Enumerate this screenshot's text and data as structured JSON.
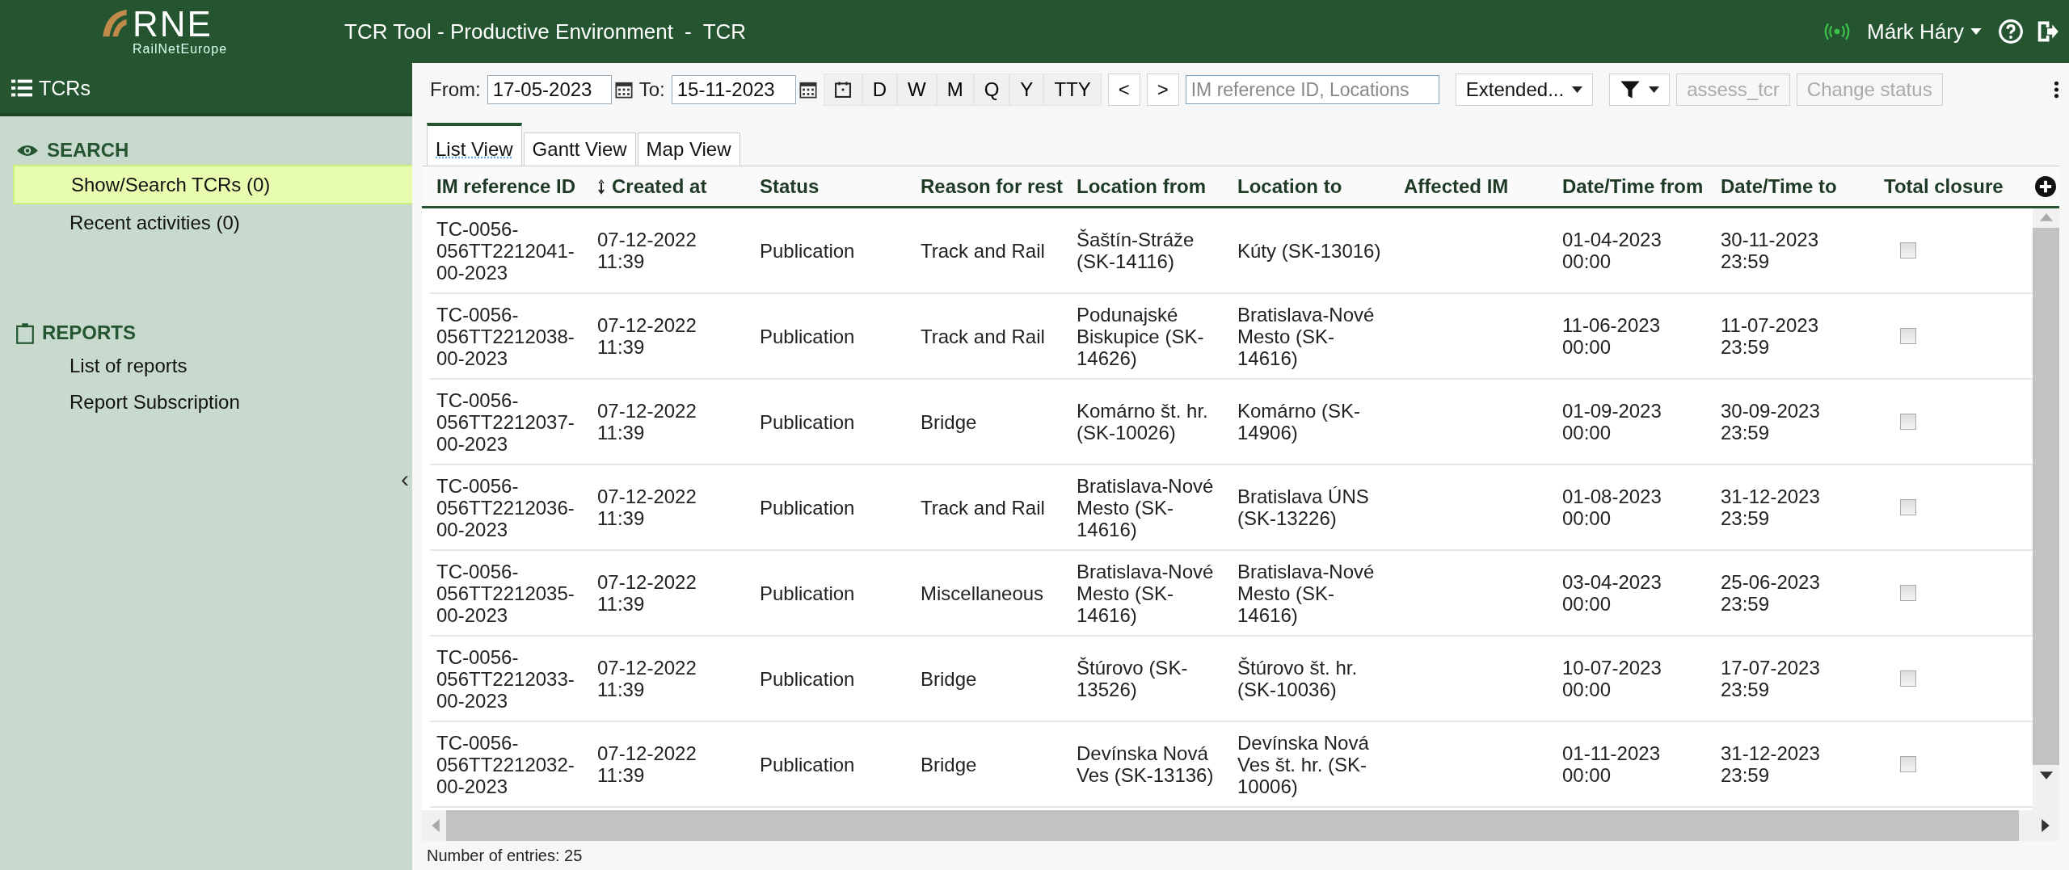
{
  "header": {
    "logo": {
      "mark": "RNE",
      "caption": "RailNetEurope"
    },
    "title": "TCR Tool - Productive Environment",
    "separator": "-",
    "module": "TCR",
    "user": "Márk Háry"
  },
  "sidebar": {
    "title": "TCRs",
    "sections": [
      {
        "kind": "search",
        "title": "SEARCH",
        "items": [
          {
            "label": "Show/Search TCRs (0)",
            "selected": true
          },
          {
            "label": "Recent activities (0)",
            "selected": false
          }
        ]
      },
      {
        "kind": "reports",
        "title": "REPORTS",
        "items": [
          {
            "label": "List of reports",
            "selected": false
          },
          {
            "label": "Report Subscription",
            "selected": false
          }
        ]
      }
    ],
    "collapse": "‹"
  },
  "toolbar": {
    "from_label": "From:",
    "from_value": "17-05-2023",
    "to_label": "To:",
    "to_value": "15-11-2023",
    "periods": [
      "D",
      "W",
      "M",
      "Q",
      "Y",
      "TTY"
    ],
    "prev": "<",
    "next": ">",
    "search": {
      "placeholder": "IM reference ID, Locations"
    },
    "view_select": "Extended...",
    "actions": [
      {
        "label": "assess_tcr",
        "disabled": true
      },
      {
        "label": "Change status",
        "disabled": true
      }
    ]
  },
  "tabs": [
    {
      "label": "List View",
      "selected": true
    },
    {
      "label": "Gantt View",
      "selected": false
    },
    {
      "label": "Map View",
      "selected": false
    }
  ],
  "table": {
    "columns": [
      {
        "label": "IM reference ID",
        "sortable": false
      },
      {
        "label": "Created at",
        "sortable": true
      },
      {
        "label": "Status",
        "sortable": false
      },
      {
        "label": "Reason for rest",
        "sortable": false
      },
      {
        "label": "Location from",
        "sortable": false
      },
      {
        "label": "Location to",
        "sortable": false
      },
      {
        "label": "Affected IM",
        "sortable": false
      },
      {
        "label": "Date/Time from",
        "sortable": false
      },
      {
        "label": "Date/Time to",
        "sortable": false
      },
      {
        "label": "Total closure",
        "sortable": false
      }
    ],
    "rows": [
      {
        "im_reference_id": "TC-0056-056TT2212041-00-2023",
        "created_at": "07-12-2022 11:39",
        "status": "Publication",
        "reason": "Track and Rail",
        "location_from": "Šaštín-Stráže (SK-14116)",
        "location_to": "Kúty (SK-13016)",
        "datetime_from": "01-04-2023 00:00",
        "datetime_to": "30-11-2023 23:59",
        "total_closure": false
      },
      {
        "im_reference_id": "TC-0056-056TT2212038-00-2023",
        "created_at": "07-12-2022 11:39",
        "status": "Publication",
        "reason": "Track and Rail",
        "location_from": "Podunajské Biskupice (SK-14626)",
        "location_to": "Bratislava-Nové Mesto (SK-14616)",
        "datetime_from": "11-06-2023 00:00",
        "datetime_to": "11-07-2023 23:59",
        "total_closure": false
      },
      {
        "im_reference_id": "TC-0056-056TT2212037-00-2023",
        "created_at": "07-12-2022 11:39",
        "status": "Publication",
        "reason": "Bridge",
        "location_from": "Komárno št. hr. (SK-10026)",
        "location_to": "Komárno (SK-14906)",
        "datetime_from": "01-09-2023 00:00",
        "datetime_to": "30-09-2023 23:59",
        "total_closure": false
      },
      {
        "im_reference_id": "TC-0056-056TT2212036-00-2023",
        "created_at": "07-12-2022 11:39",
        "status": "Publication",
        "reason": "Track and Rail",
        "location_from": "Bratislava-Nové Mesto (SK-14616)",
        "location_to": "Bratislava ÚNS (SK-13226)",
        "datetime_from": "01-08-2023 00:00",
        "datetime_to": "31-12-2023 23:59",
        "total_closure": false
      },
      {
        "im_reference_id": "TC-0056-056TT2212035-00-2023",
        "created_at": "07-12-2022 11:39",
        "status": "Publication",
        "reason": "Miscellaneous",
        "location_from": "Bratislava-Nové Mesto (SK-14616)",
        "location_to": "Bratislava-Nové Mesto (SK-14616)",
        "datetime_from": "03-04-2023 00:00",
        "datetime_to": "25-06-2023 23:59",
        "total_closure": false
      },
      {
        "im_reference_id": "TC-0056-056TT2212033-00-2023",
        "created_at": "07-12-2022 11:39",
        "status": "Publication",
        "reason": "Bridge",
        "location_from": "Štúrovo (SK-13526)",
        "location_to": "Štúrovo št. hr. (SK-10036)",
        "datetime_from": "10-07-2023 00:00",
        "datetime_to": "17-07-2023 23:59",
        "total_closure": false
      },
      {
        "im_reference_id": "TC-0056-056TT2212032-00-2023",
        "created_at": "07-12-2022 11:39",
        "status": "Publication",
        "reason": "Bridge",
        "location_from": "Devínska Nová Ves (SK-13136)",
        "location_to": "Devínska Nová Ves št. hr. (SK-10006)",
        "datetime_from": "01-11-2023 00:00",
        "datetime_to": "31-12-2023 23:59",
        "total_closure": false
      }
    ]
  },
  "footer": "Number of entries: 25"
}
